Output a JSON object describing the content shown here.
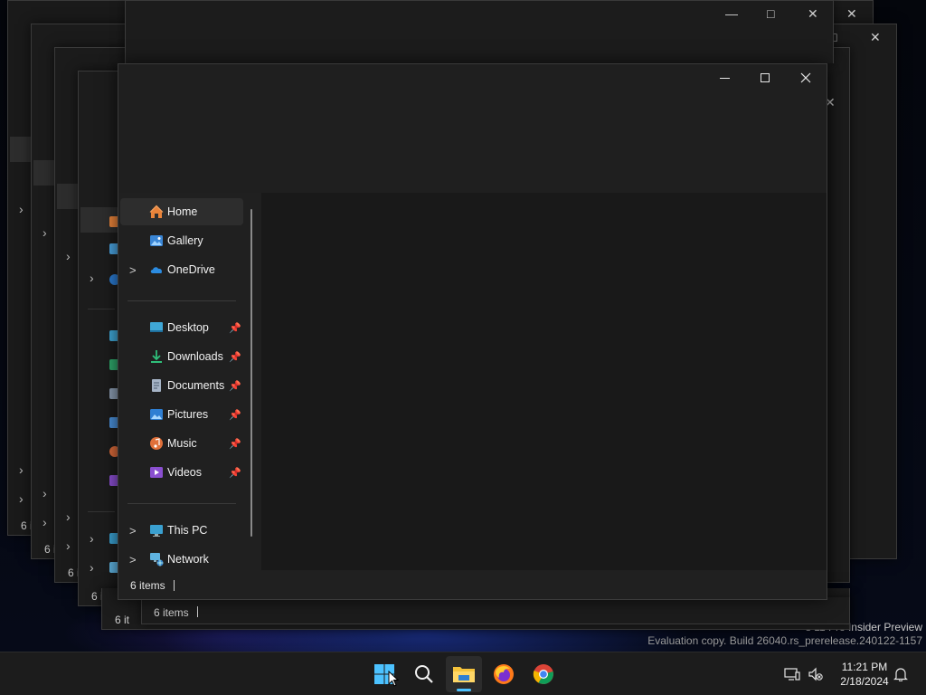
{
  "watermark": {
    "line1": "s 11 Pro Insider Preview",
    "line2": "Evaluation copy. Build 26040.rs_prerelease.240122-1157"
  },
  "window": {
    "controls": {
      "minimize": "—",
      "maximize": "□",
      "close": "✕"
    }
  },
  "nav": {
    "quick": [
      {
        "label": "Home",
        "icon": "home-icon"
      },
      {
        "label": "Gallery",
        "icon": "gallery-icon"
      },
      {
        "label": "OneDrive",
        "icon": "onedrive-icon"
      }
    ],
    "pinned": [
      {
        "label": "Desktop",
        "icon": "desktop-folder-icon"
      },
      {
        "label": "Downloads",
        "icon": "downloads-folder-icon"
      },
      {
        "label": "Documents",
        "icon": "documents-folder-icon"
      },
      {
        "label": "Pictures",
        "icon": "pictures-folder-icon"
      },
      {
        "label": "Music",
        "icon": "music-folder-icon"
      },
      {
        "label": "Videos",
        "icon": "videos-folder-icon"
      }
    ],
    "devices": [
      {
        "label": "This PC",
        "icon": "this-pc-icon"
      },
      {
        "label": "Network",
        "icon": "network-icon"
      }
    ],
    "pin_glyph": "📌",
    "chevron_glyph": ">"
  },
  "status": {
    "items_text": "6 items"
  },
  "ghost_windows": {
    "status_text": "6 items",
    "status_partial": "6 i",
    "status_partial2": "6 it"
  },
  "taskbar": {
    "apps": [
      "start-button",
      "search-button",
      "file-explorer",
      "firefox",
      "chrome"
    ],
    "clock_time": "11:21 PM",
    "clock_date": "2/18/2024"
  },
  "colors": {
    "accent": "#4cc2ff",
    "window_bg": "#202020",
    "selected_bg": "#2d2d2d"
  }
}
